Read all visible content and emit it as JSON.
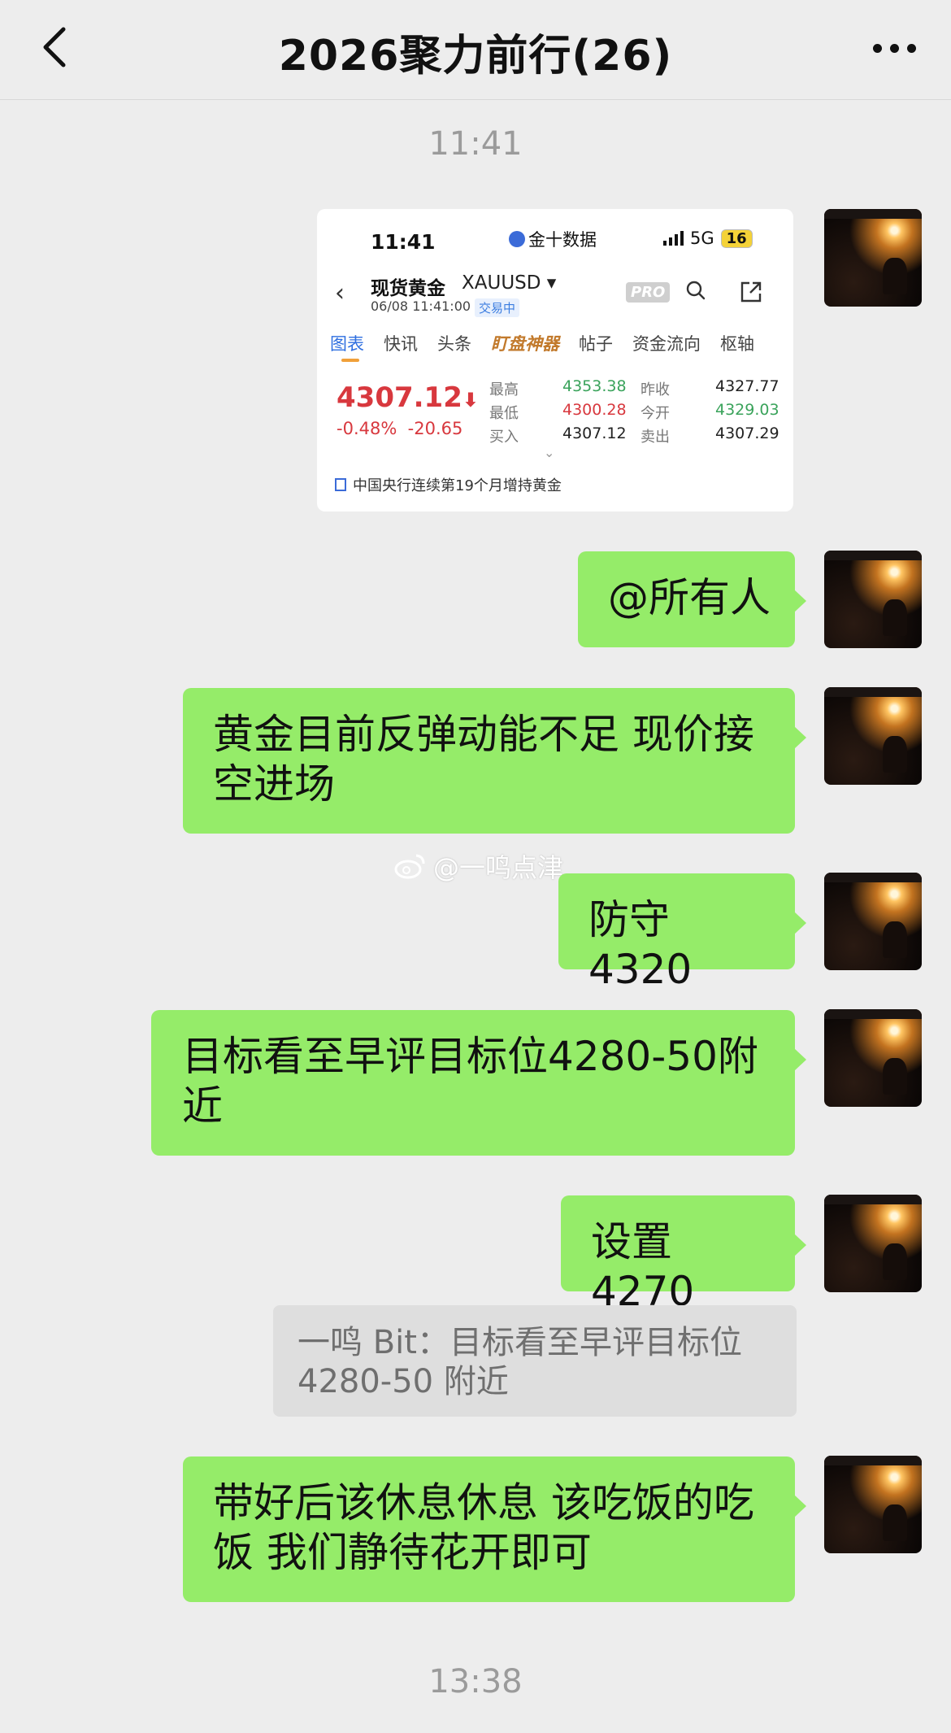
{
  "header": {
    "title": "2026聚力前行(26)",
    "back_icon": "chevron-left-icon",
    "more_icon": "more-icon"
  },
  "time_top": "11:41",
  "time_bottom": "13:38",
  "screenshot": {
    "status_time": "11:41",
    "app_label": "金十数据",
    "network": "5G",
    "battery": "16",
    "name": "现货黄金",
    "code": "XAUUSD",
    "datetime": "06/08 11:41:00",
    "trading_status": "交易中",
    "pro_label": "PRO",
    "tabs": [
      "图表",
      "快讯",
      "头条",
      "盯盘神器",
      "帖子",
      "资金流向",
      "枢轴"
    ],
    "price": "4307.12",
    "change_pct": "-0.48%",
    "change_abs": "-20.65",
    "quotes": {
      "high_label": "最高",
      "high": "4353.38",
      "low_label": "最低",
      "low": "4300.28",
      "bid_label": "买入",
      "bid": "4307.12",
      "prev_close_label": "昨收",
      "prev_close": "4327.77",
      "open_label": "今开",
      "open": "4329.03",
      "ask_label": "卖出",
      "ask": "4307.29"
    },
    "news": "中国央行连续第19个月增持黄金",
    "colors": {
      "down": "#d8383e",
      "up": "#3aa35b",
      "accent": "#2f6fe0"
    }
  },
  "messages": [
    "@所有人",
    "黄金目前反弹动能不足 现价接空进场",
    "防守4320",
    "目标看至早评目标位4280-50附近",
    "设置4270",
    "带好后该休息休息 该吃饭的吃饭 我们静待花开即可"
  ],
  "quote_reply": "一鸣 Bit：目标看至早评目标位 4280-50 附近",
  "watermark": "@一鸣点津",
  "colors": {
    "bubble": "#95ec69",
    "background": "#ededed"
  }
}
